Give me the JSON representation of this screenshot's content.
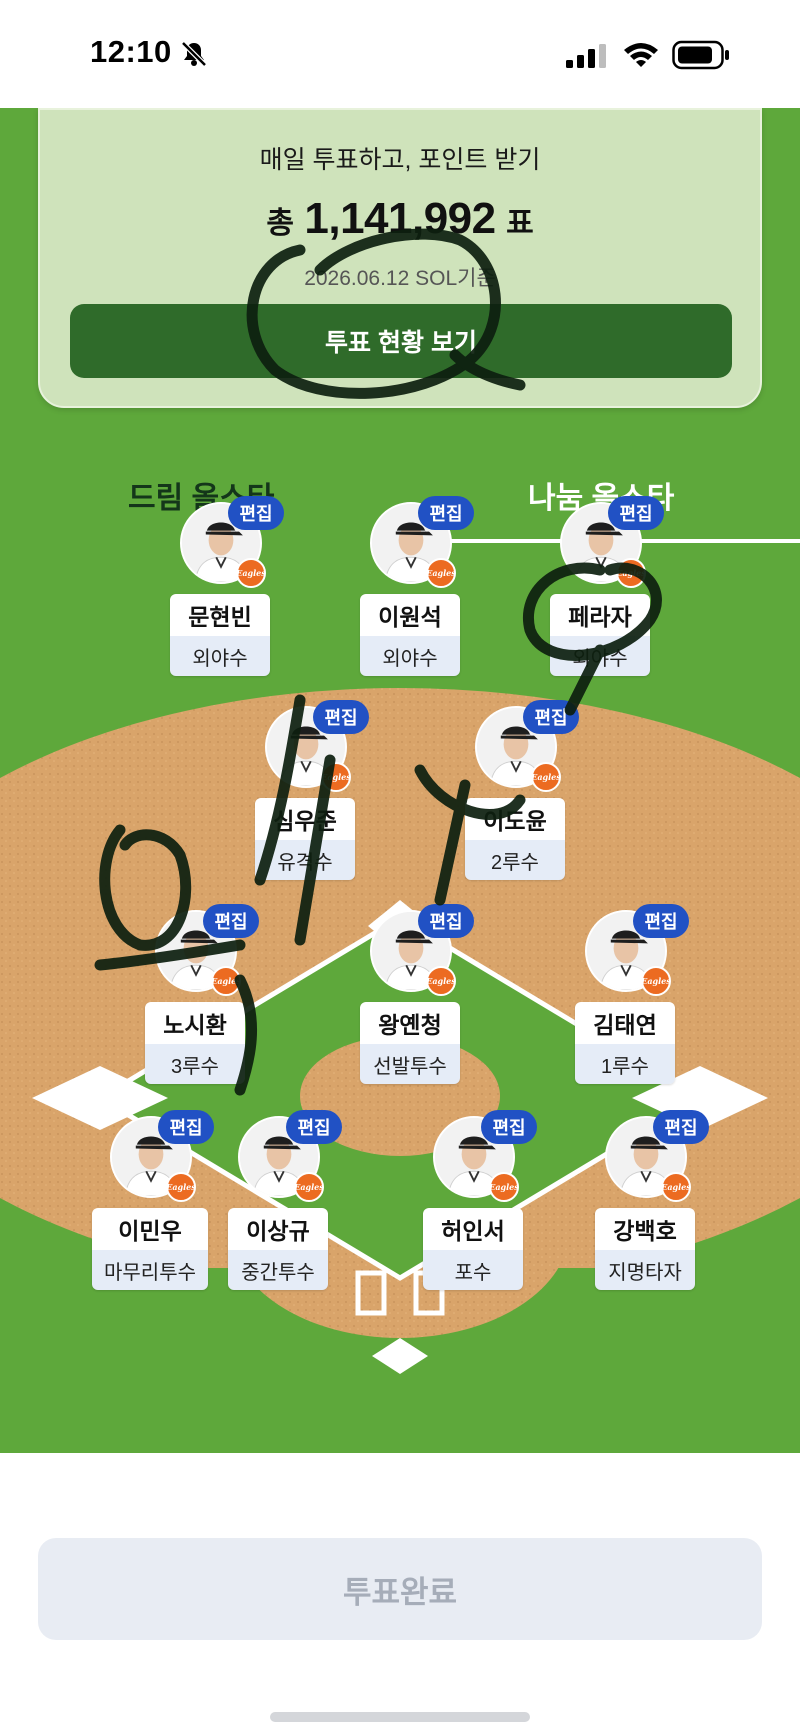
{
  "status_bar": {
    "time": "12:10"
  },
  "vote_card": {
    "title": "매일 투표하고, 포인트 받기",
    "total_prefix": "총",
    "total_count": "1,141,992",
    "total_suffix": "표",
    "date": "2026.06.12 SOL기준",
    "status_button": "투표 현황 보기"
  },
  "tabs": [
    {
      "label": "드림 올스타",
      "selected": false
    },
    {
      "label": "나눔 올스타",
      "selected": true
    }
  ],
  "edit_label": "편집",
  "team_logo": "Eagles",
  "players": [
    {
      "name": "문현빈",
      "position": "외야수"
    },
    {
      "name": "이원석",
      "position": "외야수"
    },
    {
      "name": "페라자",
      "position": "외야수"
    },
    {
      "name": "심우준",
      "position": "유격수"
    },
    {
      "name": "이도윤",
      "position": "2루수"
    },
    {
      "name": "노시환",
      "position": "3루수"
    },
    {
      "name": "왕옌청",
      "position": "선발투수"
    },
    {
      "name": "김태연",
      "position": "1루수"
    },
    {
      "name": "이민우",
      "position": "마무리투수"
    },
    {
      "name": "이상규",
      "position": "중간투수"
    },
    {
      "name": "허인서",
      "position": "포수"
    },
    {
      "name": "강백호",
      "position": "지명타자"
    }
  ],
  "complete_button": "투표완료",
  "colors": {
    "grass": "#5ea83b",
    "infield_dirt": "#d9a46a",
    "edit_badge": "#2151c4",
    "status_button": "#2f6b2a",
    "team_orange": "#ec6b21"
  },
  "icons": [
    "bell-muted-icon",
    "signal-icon",
    "wifi-icon",
    "battery-icon",
    "team-logo-icon",
    "player-avatar"
  ]
}
